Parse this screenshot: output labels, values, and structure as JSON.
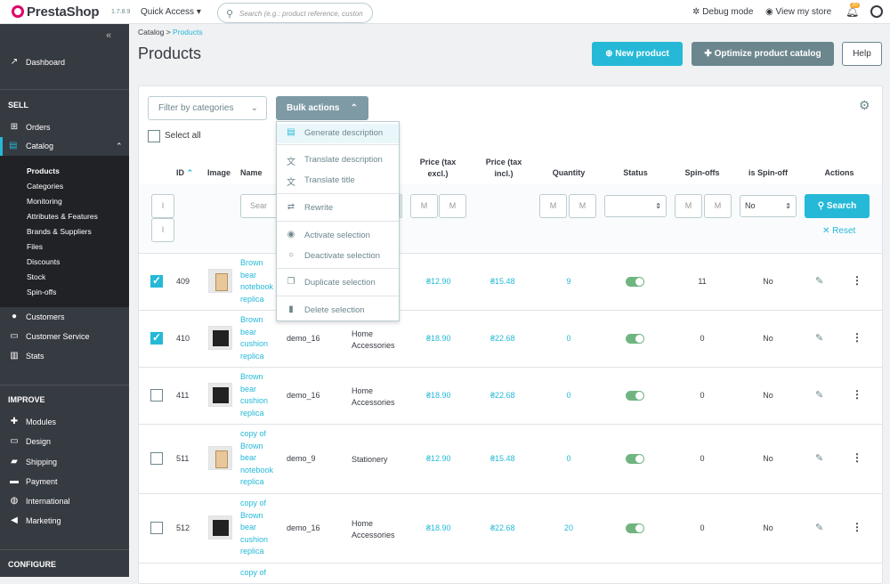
{
  "topbar": {
    "logo": "PrestaShop",
    "version": "1.7.8.9",
    "quick_access": "Quick Access",
    "search_placeholder": "Search (e.g.: product reference, custon",
    "debug": "Debug mode",
    "view_store": "View my store",
    "notif_count": "20"
  },
  "sidebar": {
    "dashboard": "Dashboard",
    "sec_sell": "SELL",
    "orders": "Orders",
    "catalog": "Catalog",
    "catalog_sub": [
      "Products",
      "Categories",
      "Monitoring",
      "Attributes & Features",
      "Brands & Suppliers",
      "Files",
      "Discounts",
      "Stock",
      "Spin-offs"
    ],
    "customers": "Customers",
    "customer_service": "Customer Service",
    "stats": "Stats",
    "sec_improve": "IMPROVE",
    "modules": "Modules",
    "design": "Design",
    "shipping": "Shipping",
    "payment": "Payment",
    "international": "International",
    "marketing": "Marketing",
    "sec_configure": "CONFIGURE"
  },
  "header": {
    "crumb_root": "Catalog",
    "crumb_sep": ">",
    "crumb_current": "Products",
    "title": "Products",
    "new_product": "New product",
    "optimize": "Optimize product catalog",
    "help": "Help"
  },
  "toolbar": {
    "filter_categories": "Filter by categories",
    "bulk_actions": "Bulk actions",
    "select_all": "Select all"
  },
  "columns": {
    "id": "ID",
    "image": "Image",
    "name": "Name",
    "price_excl_1": "Price (tax",
    "price_excl_2": "excl.)",
    "price_incl_1": "Price (tax",
    "price_incl_2": "incl.)",
    "quantity": "Quantity",
    "status": "Status",
    "spinoffs": "Spin-offs",
    "is_spinoff": "is Spin-off",
    "actions": "Actions"
  },
  "filters": {
    "id_min": "I",
    "id_max": "I",
    "name": "Sear",
    "price_min": "M",
    "price_max": "M",
    "qty_min": "M",
    "qty_max": "M",
    "spin_min": "M",
    "spin_max": "M",
    "is_spinoff": "No",
    "search": "Search",
    "reset": "Reset"
  },
  "bulk_menu": [
    "Generate description",
    "Translate description",
    "Translate title",
    "Rewrite",
    "Activate selection",
    "Deactivate selection",
    "Duplicate selection",
    "Delete selection"
  ],
  "rows": [
    {
      "checked": true,
      "id": "409",
      "name": [
        "Brown",
        "bear",
        "notebook",
        "replica"
      ],
      "ref": "",
      "category": "",
      "price_excl": "₴12.90",
      "price_incl": "₴15.48",
      "qty": "9",
      "spinoffs": "11",
      "is_spinoff": "No"
    },
    {
      "checked": true,
      "id": "410",
      "name": [
        "Brown",
        "bear",
        "cushion",
        "replica"
      ],
      "ref": "demo_16",
      "category": [
        "Home",
        "Accessories"
      ],
      "price_excl": "₴18.90",
      "price_incl": "₴22.68",
      "qty": "0",
      "spinoffs": "0",
      "is_spinoff": "No"
    },
    {
      "checked": false,
      "id": "411",
      "name": [
        "Brown",
        "bear",
        "cushion",
        "replica"
      ],
      "ref": "demo_16",
      "category": [
        "Home",
        "Accessories"
      ],
      "price_excl": "₴18.90",
      "price_incl": "₴22.68",
      "qty": "0",
      "spinoffs": "0",
      "is_spinoff": "No"
    },
    {
      "checked": false,
      "id": "511",
      "name": [
        "copy of",
        "Brown",
        "bear",
        "notebook",
        "replica"
      ],
      "ref": "demo_9",
      "category": [
        "Stationery"
      ],
      "price_excl": "₴12.90",
      "price_incl": "₴15.48",
      "qty": "0",
      "spinoffs": "0",
      "is_spinoff": "No"
    },
    {
      "checked": false,
      "id": "512",
      "name": [
        "copy of",
        "Brown",
        "bear",
        "cushion",
        "replica"
      ],
      "ref": "demo_16",
      "category": [
        "Home",
        "Accessories"
      ],
      "price_excl": "₴18.90",
      "price_incl": "₴22.68",
      "qty": "20",
      "spinoffs": "0",
      "is_spinoff": "No"
    },
    {
      "checked": false,
      "id": "",
      "name": [
        "copy of"
      ],
      "ref": "",
      "category": [],
      "price_excl": "",
      "price_incl": "",
      "qty": "",
      "spinoffs": "",
      "is_spinoff": ""
    }
  ]
}
